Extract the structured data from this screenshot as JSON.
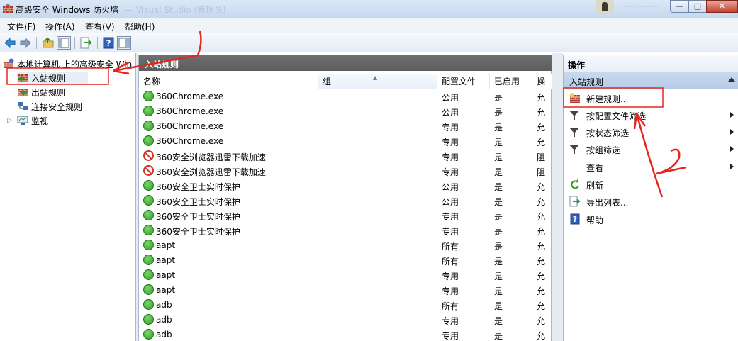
{
  "window": {
    "title": "高级安全 Windows 防火墙",
    "ghost_title": "— Visual Studio (管理员)",
    "ghost_title2": "— ›———",
    "min_glyph": "—",
    "max_glyph": "□",
    "close_glyph": "✕"
  },
  "menu": {
    "items": [
      {
        "label": "文件(F)"
      },
      {
        "label": "操作(A)"
      },
      {
        "label": "查看(V)"
      },
      {
        "label": "帮助(H)"
      }
    ]
  },
  "toolbar": {
    "buttons": [
      {
        "icon": "back-arrow-icon"
      },
      {
        "icon": "forward-arrow-icon"
      },
      {
        "icon": "up-folder-icon"
      },
      {
        "icon": "show-hide-console-tree-icon"
      },
      {
        "icon": "export-list-icon"
      },
      {
        "icon": "help-icon"
      },
      {
        "icon": "show-hide-action-pane-icon"
      }
    ]
  },
  "tree": {
    "root": "本地计算机 上的高级安全 Win",
    "items": [
      {
        "label": "入站规则",
        "icon": "inbound-rules-icon",
        "selected": true
      },
      {
        "label": "出站规则",
        "icon": "outbound-rules-icon"
      },
      {
        "label": "连接安全规则",
        "icon": "connection-security-rules-icon"
      },
      {
        "label": "监视",
        "icon": "monitoring-icon"
      }
    ]
  },
  "center": {
    "header": "入站规则",
    "columns": [
      "名称",
      "组",
      "配置文件",
      "已启用",
      "操"
    ],
    "rows": [
      {
        "name": "360Chrome.exe",
        "group": "",
        "profile": "公用",
        "enabled": "是",
        "action": "允",
        "status": "allow"
      },
      {
        "name": "360Chrome.exe",
        "group": "",
        "profile": "公用",
        "enabled": "是",
        "action": "允",
        "status": "allow"
      },
      {
        "name": "360Chrome.exe",
        "group": "",
        "profile": "专用",
        "enabled": "是",
        "action": "允",
        "status": "allow"
      },
      {
        "name": "360Chrome.exe",
        "group": "",
        "profile": "专用",
        "enabled": "是",
        "action": "允",
        "status": "allow"
      },
      {
        "name": "360安全浏览器迅雷下载加速",
        "group": "",
        "profile": "专用",
        "enabled": "是",
        "action": "阻",
        "status": "block"
      },
      {
        "name": "360安全浏览器迅雷下载加速",
        "group": "",
        "profile": "专用",
        "enabled": "是",
        "action": "阻",
        "status": "block"
      },
      {
        "name": "360安全卫士实时保护",
        "group": "",
        "profile": "公用",
        "enabled": "是",
        "action": "允",
        "status": "allow"
      },
      {
        "name": "360安全卫士实时保护",
        "group": "",
        "profile": "公用",
        "enabled": "是",
        "action": "允",
        "status": "allow"
      },
      {
        "name": "360安全卫士实时保护",
        "group": "",
        "profile": "专用",
        "enabled": "是",
        "action": "允",
        "status": "allow"
      },
      {
        "name": "360安全卫士实时保护",
        "group": "",
        "profile": "专用",
        "enabled": "是",
        "action": "允",
        "status": "allow"
      },
      {
        "name": "aapt",
        "group": "",
        "profile": "所有",
        "enabled": "是",
        "action": "允",
        "status": "allow"
      },
      {
        "name": "aapt",
        "group": "",
        "profile": "所有",
        "enabled": "是",
        "action": "允",
        "status": "allow"
      },
      {
        "name": "aapt",
        "group": "",
        "profile": "专用",
        "enabled": "是",
        "action": "允",
        "status": "allow"
      },
      {
        "name": "aapt",
        "group": "",
        "profile": "专用",
        "enabled": "是",
        "action": "允",
        "status": "allow"
      },
      {
        "name": "adb",
        "group": "",
        "profile": "所有",
        "enabled": "是",
        "action": "允",
        "status": "allow"
      },
      {
        "name": "adb",
        "group": "",
        "profile": "专用",
        "enabled": "是",
        "action": "允",
        "status": "allow"
      },
      {
        "name": "adb",
        "group": "",
        "profile": "专用",
        "enabled": "是",
        "action": "允",
        "status": "allow"
      }
    ]
  },
  "actions": {
    "title": "操作",
    "section": "入站规则",
    "items": [
      {
        "label": "新建规则...",
        "icon": "new-rule-icon",
        "submenu": false
      },
      {
        "label": "按配置文件筛选",
        "icon": "filter-icon",
        "submenu": true
      },
      {
        "label": "按状态筛选",
        "icon": "filter-icon",
        "submenu": true
      },
      {
        "label": "按组筛选",
        "icon": "filter-icon",
        "submenu": true
      },
      {
        "label": "查看",
        "icon": "",
        "submenu": true
      },
      {
        "label": "刷新",
        "icon": "refresh-icon",
        "submenu": false
      },
      {
        "label": "导出列表...",
        "icon": "export-list-icon",
        "submenu": false
      },
      {
        "label": "帮助",
        "icon": "help-icon",
        "submenu": false
      }
    ]
  },
  "annotations": {
    "label1": "1",
    "label2": "2",
    "color": "#e0281f"
  }
}
